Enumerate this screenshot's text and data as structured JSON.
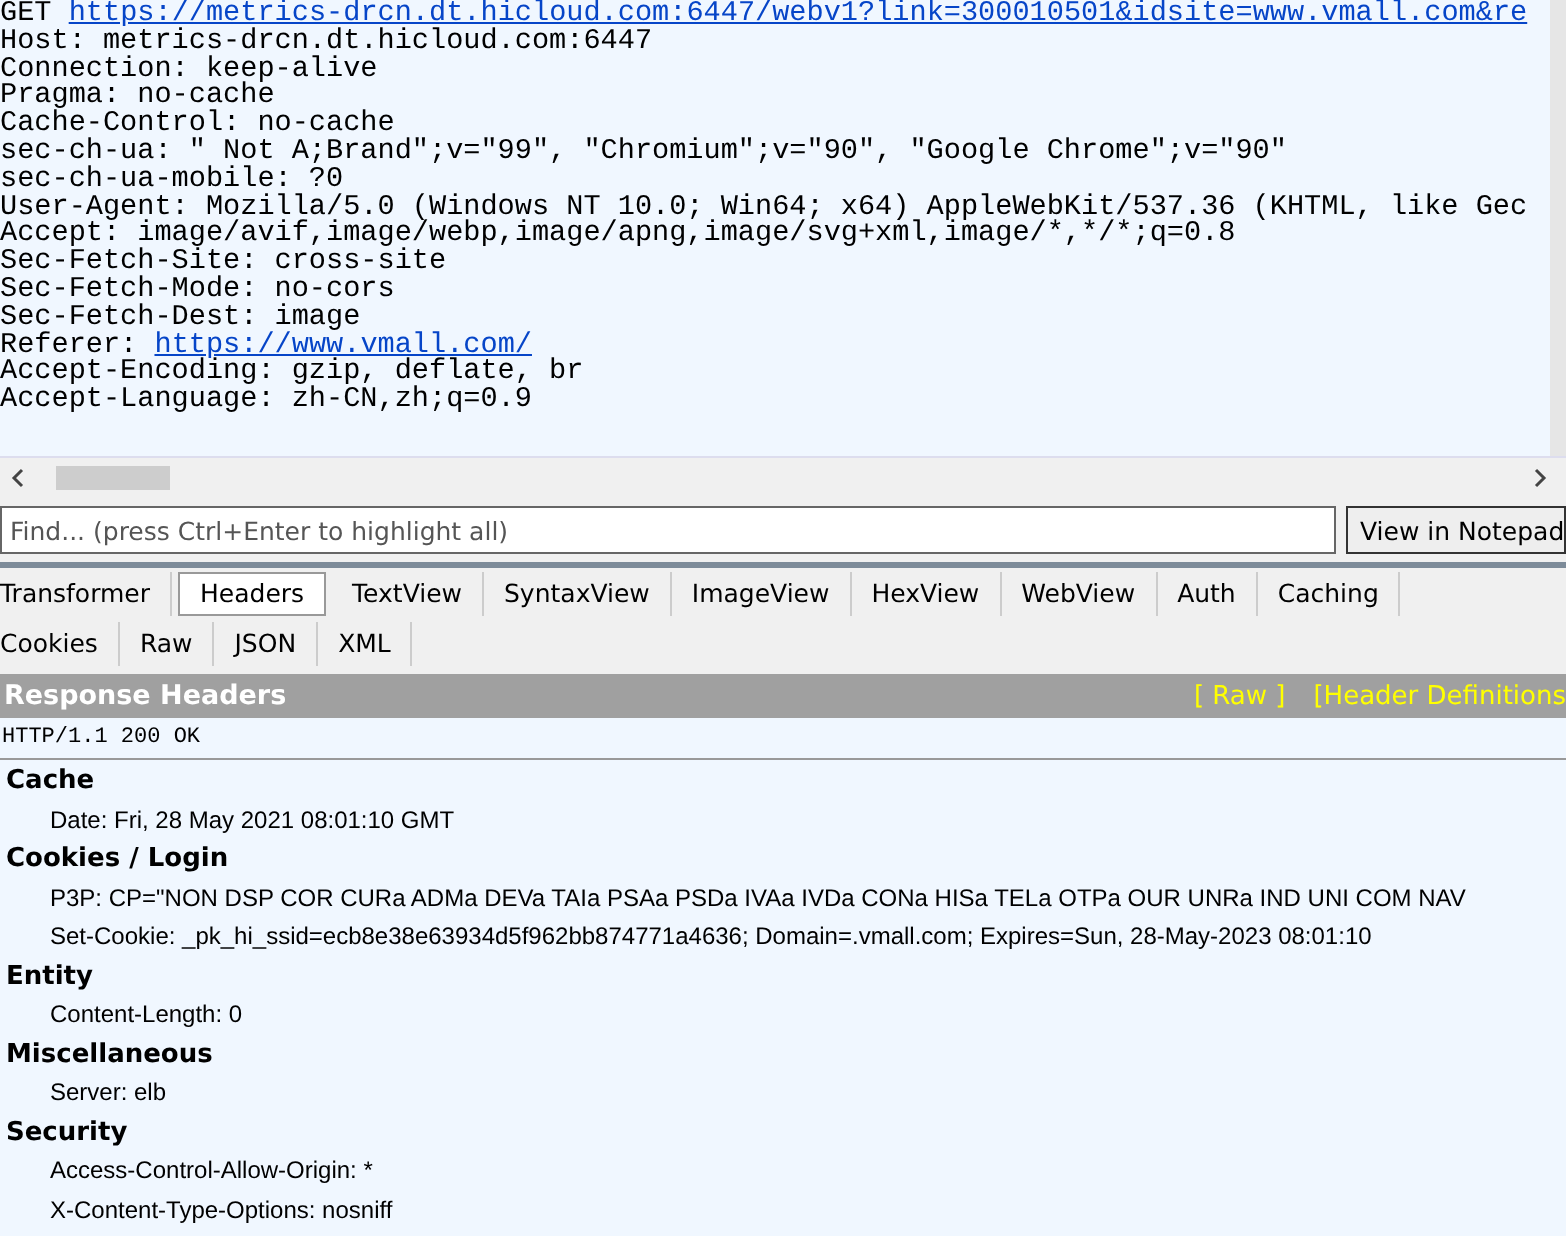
{
  "request": {
    "lines": [
      {
        "kind": "request-line",
        "method": "GET",
        "url": "https://metrics-drcn.dt.hicloud.com:6447/webv1?link=300010501&idsite=www.vmall.com&re"
      },
      {
        "kind": "plain",
        "text": "Host: metrics-drcn.dt.hicloud.com:6447"
      },
      {
        "kind": "plain",
        "text": "Connection: keep-alive"
      },
      {
        "kind": "plain",
        "text": "Pragma: no-cache"
      },
      {
        "kind": "plain",
        "text": "Cache-Control: no-cache"
      },
      {
        "kind": "plain",
        "text": "sec-ch-ua: \" Not A;Brand\";v=\"99\", \"Chromium\";v=\"90\", \"Google Chrome\";v=\"90\""
      },
      {
        "kind": "plain",
        "text": "sec-ch-ua-mobile: ?0"
      },
      {
        "kind": "plain",
        "text": "User-Agent: Mozilla/5.0 (Windows NT 10.0; Win64; x64) AppleWebKit/537.36 (KHTML, like Gec"
      },
      {
        "kind": "plain",
        "text": "Accept: image/avif,image/webp,image/apng,image/svg+xml,image/*,*/*;q=0.8"
      },
      {
        "kind": "plain",
        "text": "Sec-Fetch-Site: cross-site"
      },
      {
        "kind": "plain",
        "text": "Sec-Fetch-Mode: no-cors"
      },
      {
        "kind": "plain",
        "text": "Sec-Fetch-Dest: image"
      },
      {
        "kind": "link",
        "label": "Referer:",
        "url": "https://www.vmall.com/"
      },
      {
        "kind": "plain",
        "text": "Accept-Encoding: gzip, deflate, br"
      },
      {
        "kind": "plain",
        "text": "Accept-Language: zh-CN,zh;q=0.9"
      }
    ]
  },
  "find": {
    "placeholder": "Find... (press Ctrl+Enter to highlight all)",
    "button": "View in Notepad"
  },
  "tabs": [
    [
      {
        "label": "Transformer",
        "selected": false
      },
      {
        "label": "Headers",
        "selected": true
      },
      {
        "label": "TextView",
        "selected": false
      },
      {
        "label": "SyntaxView",
        "selected": false
      },
      {
        "label": "ImageView",
        "selected": false
      },
      {
        "label": "HexView",
        "selected": false
      },
      {
        "label": "WebView",
        "selected": false
      },
      {
        "label": "Auth",
        "selected": false
      },
      {
        "label": "Caching",
        "selected": false
      }
    ],
    [
      {
        "label": "Cookies",
        "selected": false
      },
      {
        "label": "Raw",
        "selected": false
      },
      {
        "label": "JSON",
        "selected": false
      },
      {
        "label": "XML",
        "selected": false
      }
    ]
  ],
  "response": {
    "title": "Response Headers",
    "links": [
      "[ Raw ]",
      "[Header Definitions"
    ],
    "status_line": "HTTP/1.1 200 OK",
    "groups": [
      {
        "name": "Cache",
        "headers": [
          "Date: Fri, 28 May 2021 08:01:10 GMT"
        ]
      },
      {
        "name": "Cookies / Login",
        "headers": [
          "P3P: CP=\"NON DSP COR CURa ADMa DEVa TAIa PSAa PSDa IVAa IVDa CONa HISa TELa OTPa OUR UNRa IND UNI COM NAV",
          "Set-Cookie: _pk_hi_ssid=ecb8e38e63934d5f962bb874771a4636; Domain=.vmall.com; Expires=Sun, 28-May-2023 08:01:10"
        ]
      },
      {
        "name": "Entity",
        "headers": [
          "Content-Length: 0"
        ]
      },
      {
        "name": "Miscellaneous",
        "headers": [
          "Server: elb"
        ]
      },
      {
        "name": "Security",
        "headers": [
          "Access-Control-Allow-Origin: *",
          "X-Content-Type-Options: nosniff"
        ]
      }
    ]
  }
}
